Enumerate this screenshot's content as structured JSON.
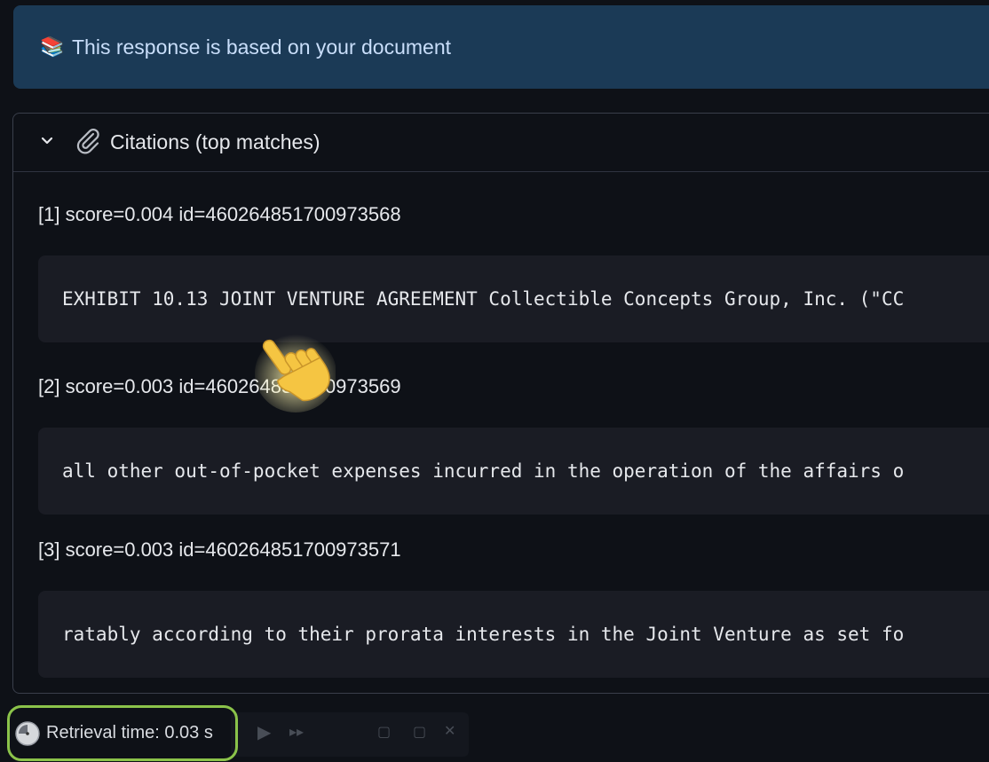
{
  "banner": {
    "icon": "books-icon",
    "text": "This response is based on your document"
  },
  "citations": {
    "title": "Citations (top matches)",
    "items": [
      {
        "label": "[1] score=0.004 id=460264851700973568",
        "snippet": "EXHIBIT 10.13 JOINT VENTURE AGREEMENT Collectible Concepts Group, Inc. (\"CC"
      },
      {
        "label": "[2] score=0.003 id=460264851700973569",
        "snippet": "all other out-of-pocket expenses incurred in the operation of the affairs o"
      },
      {
        "label": "[3] score=0.003 id=460264851700973571",
        "snippet": "ratably according to their prorata interests in the Joint Venture as set fo"
      }
    ]
  },
  "retrieval": {
    "text": "Retrieval time: 0.03 s"
  },
  "colors": {
    "banner_bg": "#1b3a56",
    "highlight": "#8bc34a",
    "page_bg": "#0e1117"
  }
}
